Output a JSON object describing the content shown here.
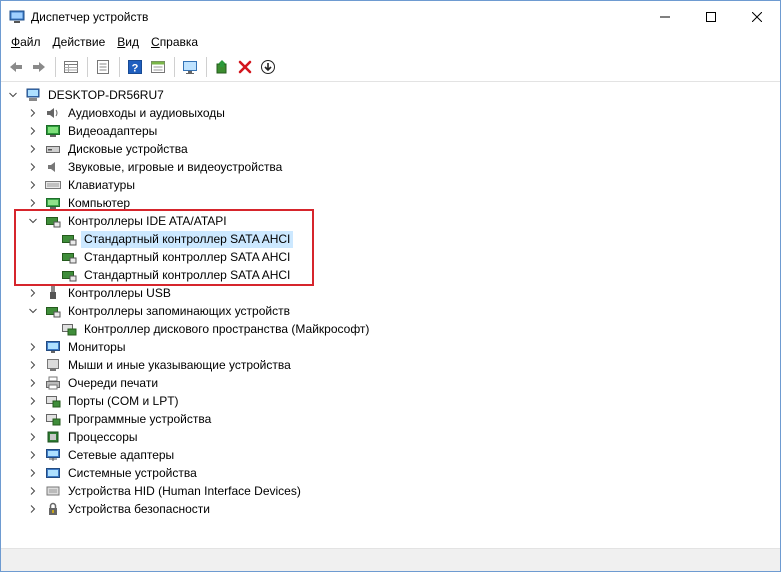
{
  "window": {
    "title": "Диспетчер устройств"
  },
  "menu": [
    {
      "underline": "Ф",
      "rest": "айл"
    },
    {
      "underline": "Д",
      "rest": "ействие"
    },
    {
      "underline": "В",
      "rest": "ид"
    },
    {
      "underline": "С",
      "rest": "правка"
    }
  ],
  "toolbar": {
    "icons": [
      "back-icon",
      "forward-icon",
      "properties-grid-icon",
      "driver-details-icon",
      "help-icon",
      "view-icon",
      "monitor-scan-icon",
      "update-driver-icon",
      "uninstall-icon",
      "download-icon"
    ]
  },
  "tree": {
    "root": "DESKTOP-DR56RU7",
    "categories": [
      {
        "label": "Аудиовходы и аудиовыходы",
        "expanded": false
      },
      {
        "label": "Видеоадаптеры",
        "expanded": false
      },
      {
        "label": "Дисковые устройства",
        "expanded": false
      },
      {
        "label": "Звуковые, игровые и видеоустройства",
        "expanded": false
      },
      {
        "label": "Клавиатуры",
        "expanded": false
      },
      {
        "label": "Компьютер",
        "expanded": false
      },
      {
        "label": "Контроллеры IDE ATA/ATAPI",
        "expanded": true,
        "children": [
          "Стандартный контроллер SATA AHCI",
          "Стандартный контроллер SATA AHCI",
          "Стандартный контроллер SATA AHCI"
        ]
      },
      {
        "label": "Контроллеры USB",
        "expanded": false
      },
      {
        "label": "Контроллеры запоминающих устройств",
        "expanded": true,
        "children": [
          "Контроллер дискового пространства (Майкрософт)"
        ]
      },
      {
        "label": "Мониторы",
        "expanded": false
      },
      {
        "label": "Мыши и иные указывающие устройства",
        "expanded": false
      },
      {
        "label": "Очереди печати",
        "expanded": false
      },
      {
        "label": "Порты (COM и LPT)",
        "expanded": false
      },
      {
        "label": "Программные устройства",
        "expanded": false
      },
      {
        "label": "Процессоры",
        "expanded": false
      },
      {
        "label": "Сетевые адаптеры",
        "expanded": false
      },
      {
        "label": "Системные устройства",
        "expanded": false
      },
      {
        "label": "Устройства HID (Human Interface Devices)",
        "expanded": false
      },
      {
        "label": "Устройства безопасности",
        "expanded": false
      }
    ]
  },
  "colors": {
    "highlight": "#d6252c",
    "selection": "#cce8ff",
    "accent": "#0063b1"
  }
}
